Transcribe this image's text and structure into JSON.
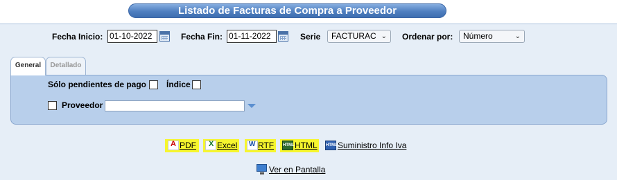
{
  "title": "Listado de Facturas de Compra a Proveedor",
  "filters": {
    "fecha_inicio_label": "Fecha Inicio:",
    "fecha_inicio_value": "01-10-2022",
    "fecha_fin_label": "Fecha Fin:",
    "fecha_fin_value": "01-11-2022",
    "serie_label": "Serie",
    "serie_value": "FACTURAC",
    "ordenar_label": "Ordenar por:",
    "ordenar_value": "Número"
  },
  "tabs": [
    {
      "label": "General",
      "active": true
    },
    {
      "label": "Detallado",
      "active": false
    }
  ],
  "general": {
    "solo_pendientes_label": "Sólo pendientes de pago",
    "solo_pendientes_checked": false,
    "indice_label": "Índice",
    "indice_checked": false,
    "proveedor_label": "Proveedor",
    "proveedor_checked": false,
    "proveedor_value": ""
  },
  "exports": {
    "pdf": "PDF",
    "excel": "Excel",
    "rtf": "RTF",
    "html": "HTML",
    "suministro": "Suministro Info Iva",
    "html_icon_text": "HTML"
  },
  "ver_pantalla": "Ver en Pantalla",
  "colors": {
    "title_bar": "#4f7fc0",
    "panel": "#b8cfeb",
    "background": "#e6eef7",
    "highlight": "#f6f62e"
  },
  "icons": {
    "calendar": "calendar-icon",
    "pdf": "pdf-icon",
    "excel": "excel-icon",
    "rtf": "rtf-icon",
    "html": "html-icon",
    "monitor": "monitor-icon",
    "dropdown": "dropdown-triangle-icon"
  }
}
